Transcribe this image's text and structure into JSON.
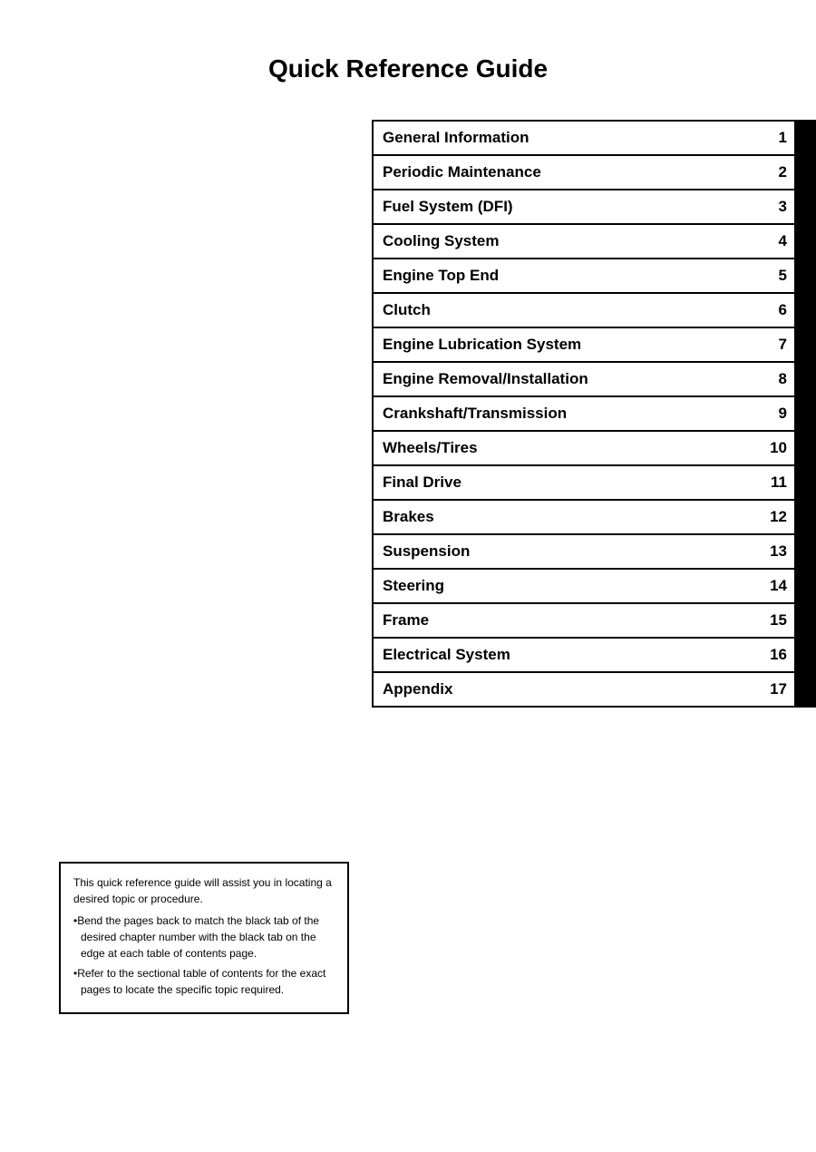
{
  "page": {
    "title": "Quick Reference Guide"
  },
  "toc": {
    "items": [
      {
        "label": "General Information",
        "number": "1"
      },
      {
        "label": "Periodic Maintenance",
        "number": "2"
      },
      {
        "label": "Fuel System (DFI)",
        "number": "3"
      },
      {
        "label": "Cooling System",
        "number": "4"
      },
      {
        "label": "Engine Top End",
        "number": "5"
      },
      {
        "label": "Clutch",
        "number": "6"
      },
      {
        "label": "Engine Lubrication System",
        "number": "7"
      },
      {
        "label": "Engine Removal/Installation",
        "number": "8"
      },
      {
        "label": "Crankshaft/Transmission",
        "number": "9"
      },
      {
        "label": "Wheels/Tires",
        "number": "10"
      },
      {
        "label": "Final Drive",
        "number": "11"
      },
      {
        "label": "Brakes",
        "number": "12"
      },
      {
        "label": "Suspension",
        "number": "13"
      },
      {
        "label": "Steering",
        "number": "14"
      },
      {
        "label": "Frame",
        "number": "15"
      },
      {
        "label": "Electrical System",
        "number": "16"
      },
      {
        "label": "Appendix",
        "number": "17"
      }
    ]
  },
  "note": {
    "intro": "This quick reference guide will assist you in locating a desired topic or procedure.",
    "bullet1": "•Bend the pages back to match the black tab of the desired chapter number with the black tab on the edge at each table of contents page.",
    "bullet2": "•Refer to the sectional table of contents for the exact pages to locate the specific topic required."
  }
}
